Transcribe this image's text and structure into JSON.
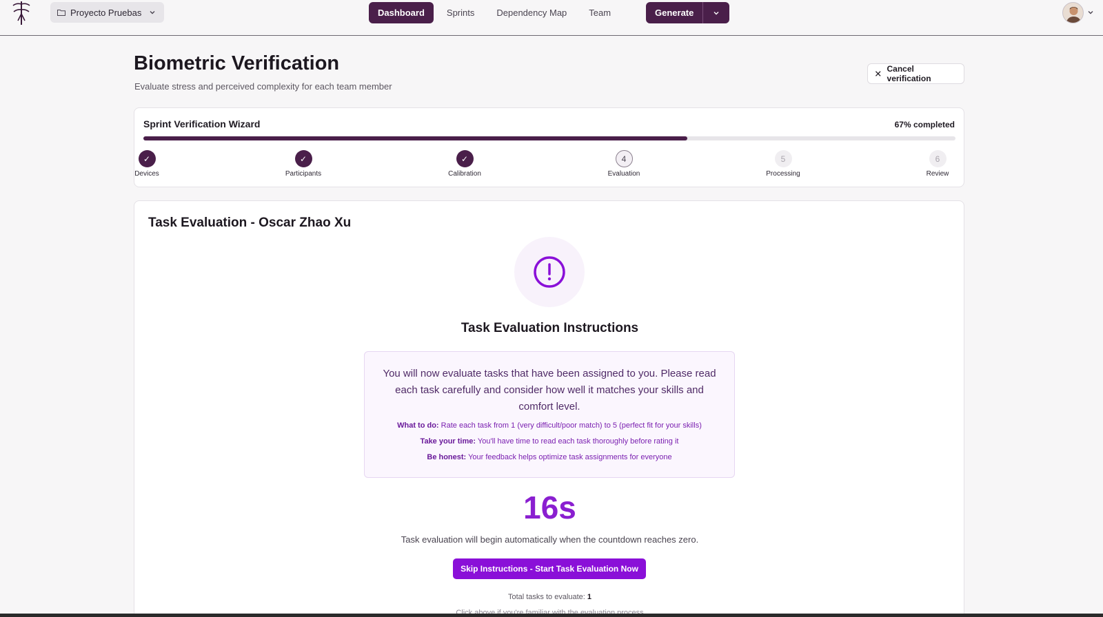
{
  "topbar": {
    "project_label": "Proyecto Pruebas",
    "tabs": [
      {
        "label": "Dashboard",
        "active": true
      },
      {
        "label": "Sprints",
        "active": false
      },
      {
        "label": "Dependency Map",
        "active": false
      },
      {
        "label": "Team",
        "active": false
      }
    ],
    "generate_label": "Generate",
    "brand_color": "#4a1f4a"
  },
  "header": {
    "title": "Biometric Verification",
    "subtitle": "Evaluate stress and perceived complexity for each team member",
    "cancel_label": "Cancel verification"
  },
  "wizard": {
    "title": "Sprint Verification Wizard",
    "percent_label": "67% completed",
    "progress": 0.67,
    "steps": [
      {
        "label": "Devices",
        "state": "done",
        "marker": "✓"
      },
      {
        "label": "Participants",
        "state": "done",
        "marker": "✓"
      },
      {
        "label": "Calibration",
        "state": "done",
        "marker": "✓"
      },
      {
        "label": "Evaluation",
        "state": "current",
        "marker": "4"
      },
      {
        "label": "Processing",
        "state": "pending",
        "marker": "5"
      },
      {
        "label": "Review",
        "state": "pending",
        "marker": "6"
      }
    ]
  },
  "evaluation": {
    "title": "Task Evaluation - Oscar Zhao Xu",
    "icon": "alert-circle-icon",
    "instructions_title": "Task Evaluation Instructions",
    "lead": "You will now evaluate tasks that have been assigned to you. Please read each task carefully and consider how well it matches your skills and comfort level.",
    "items": [
      {
        "key": "What to do:",
        "text": "Rate each task from 1 (very difficult/poor match) to 5 (perfect fit for your skills)"
      },
      {
        "key": "Take your time:",
        "text": "You'll have time to read each task thoroughly before rating it"
      },
      {
        "key": "Be honest:",
        "text": "Your feedback helps optimize task assignments for everyone"
      }
    ],
    "countdown": "16s",
    "countdown_note": "Task evaluation will begin automatically when the countdown reaches zero.",
    "skip_label": "Skip Instructions - Start Task Evaluation Now",
    "total_label": "Total tasks to evaluate:",
    "total_value": "1",
    "familiar_note": "Click above if you're familiar with the evaluation process",
    "accent_color": "#8a10d8"
  }
}
